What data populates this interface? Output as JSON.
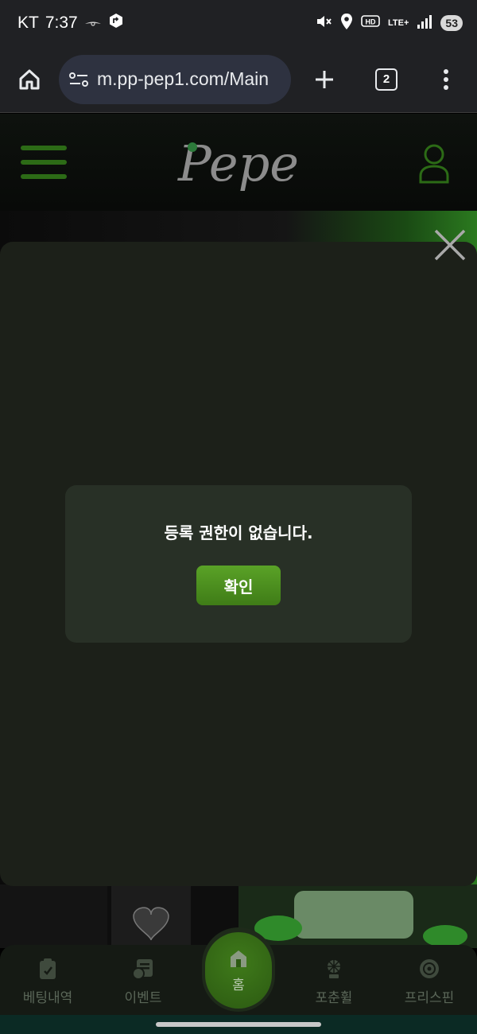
{
  "status_bar": {
    "carrier": "KT",
    "time": "7:37",
    "network": "LTE+",
    "battery": "53"
  },
  "browser": {
    "url": "m.pp-pep1.com/Main",
    "tab_count": "2"
  },
  "site": {
    "logo_text": "Pepe"
  },
  "dialog": {
    "message": "등록 권한이 없습니다.",
    "confirm_label": "확인"
  },
  "bottom_nav": {
    "items": [
      {
        "label": "베팅내역",
        "icon": "clipboard-icon"
      },
      {
        "label": "이벤트",
        "icon": "event-icon"
      },
      {
        "label": "홈",
        "icon": "home-icon"
      },
      {
        "label": "포춘휠",
        "icon": "fortune-wheel-icon"
      },
      {
        "label": "프리스핀",
        "icon": "free-spin-icon"
      }
    ]
  },
  "colors": {
    "accent_green": "#4f9620",
    "overlay_bg": "#1c2019",
    "dialog_bg": "#283026"
  }
}
